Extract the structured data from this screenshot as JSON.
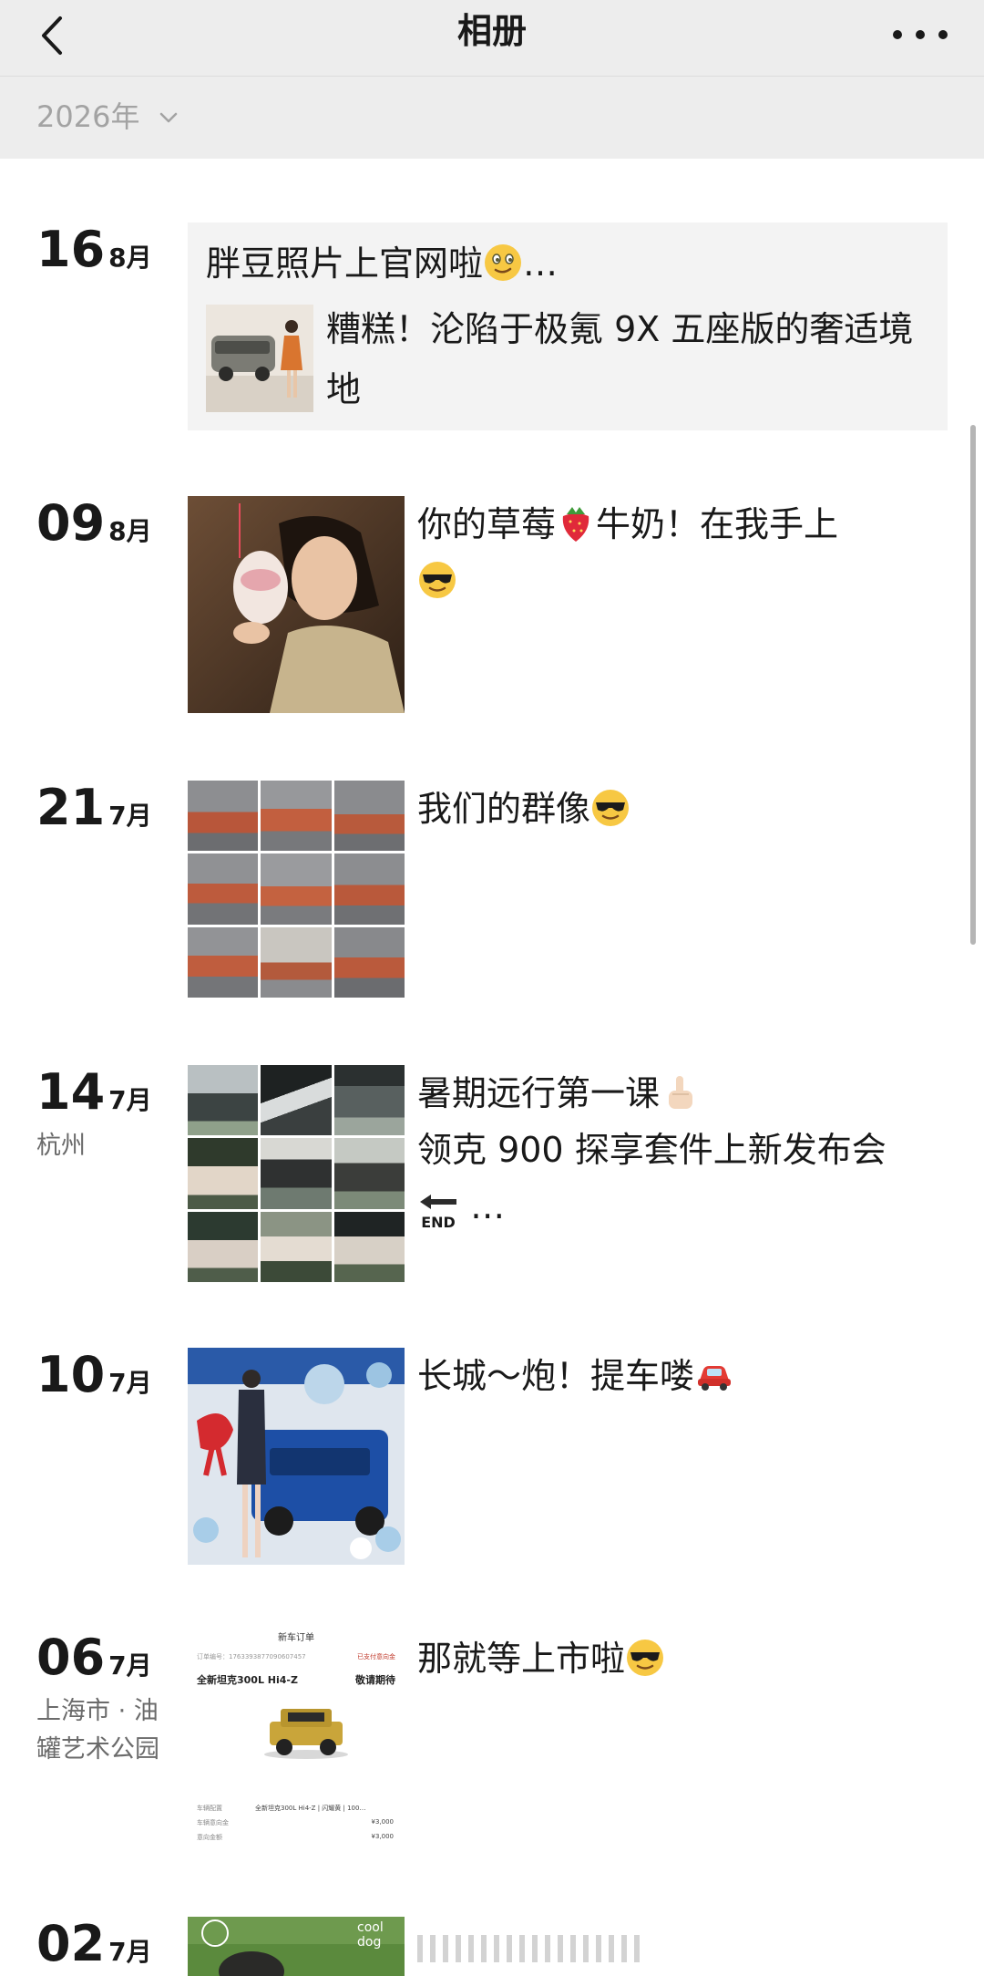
{
  "nav": {
    "title": "相册"
  },
  "year_filter": {
    "label": "2026年"
  },
  "entries": [
    {
      "day": "16",
      "month": "8月",
      "share_title": "胖豆照片上官网啦",
      "share_ellipsis": "…",
      "share_text": "糟糕！沦陷于极氪 9X 五座版的奢适境地"
    },
    {
      "day": "09",
      "month": "8月",
      "caption_1": "你的草莓",
      "caption_2": "牛奶！在我手上"
    },
    {
      "day": "21",
      "month": "7月",
      "caption": "我们的群像"
    },
    {
      "day": "14",
      "month": "7月",
      "location": "杭州",
      "caption_line1": "暑期远行第一课",
      "caption_line2": "领克 900 探享套件上新发布会",
      "end_label": "END",
      "ellipsis": "…"
    },
    {
      "day": "10",
      "month": "7月",
      "caption": "长城～炮！提车喽"
    },
    {
      "day": "06",
      "month": "7月",
      "location": "上海市 · 油罐艺术公园",
      "caption": "那就等上市啦",
      "order": {
        "header": "新车订单",
        "order_no": "订单编号：1763393877090607457",
        "status": "已支付意向金",
        "model": "全新坦克300L Hi4-Z",
        "delivery": "敬请期待",
        "row1_label": "车辆配置",
        "row1_value": "全新坦克300L Hi4-Z | 闪耀黄 | 100…",
        "row2_label": "车辆意向金",
        "row2_value": "¥3,000",
        "row3_label": "意向金额",
        "row3_value": "¥3,000"
      }
    },
    {
      "day": "02",
      "month": "7月",
      "thumb_text": "cool dog"
    }
  ]
}
